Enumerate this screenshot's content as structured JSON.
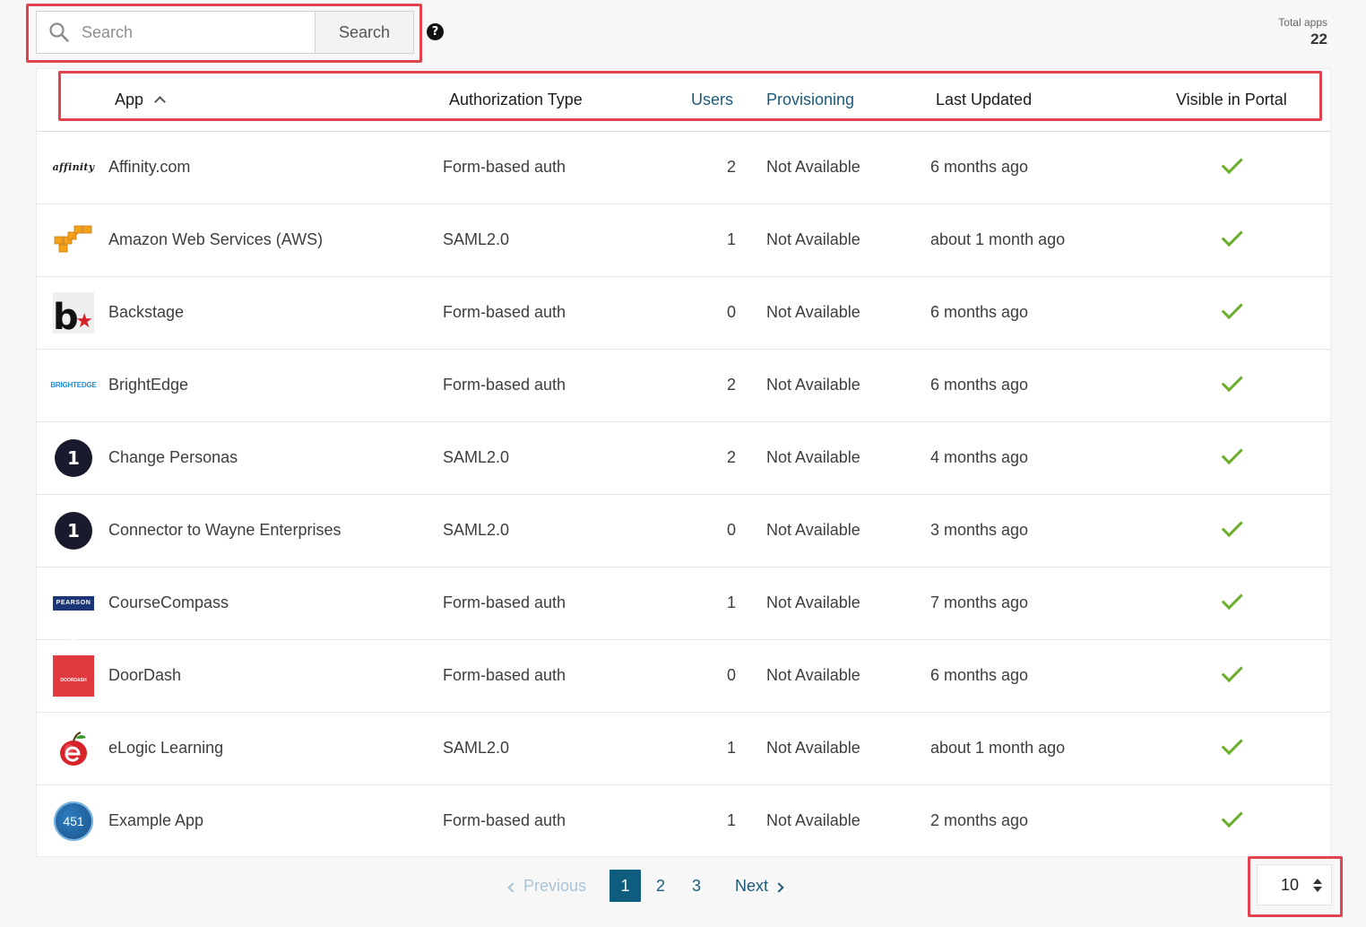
{
  "search": {
    "placeholder": "Search",
    "button_label": "Search",
    "help_glyph": "?"
  },
  "total_apps": {
    "label": "Total apps",
    "value": "22"
  },
  "table": {
    "columns": {
      "app": "App",
      "auth": "Authorization Type",
      "users": "Users",
      "provisioning": "Provisioning",
      "last_updated": "Last Updated",
      "visible": "Visible in Portal"
    },
    "rows": [
      {
        "name": "Affinity.com",
        "auth": "Form-based auth",
        "users": "2",
        "provisioning": "Not Available",
        "updated": "6 months ago",
        "logo_text": "affinity"
      },
      {
        "name": "Amazon Web Services (AWS)",
        "auth": "SAML2.0",
        "users": "1",
        "provisioning": "Not Available",
        "updated": "about 1 month ago"
      },
      {
        "name": "Backstage",
        "auth": "Form-based auth",
        "users": "0",
        "provisioning": "Not Available",
        "updated": "6 months ago",
        "logo_text": "b"
      },
      {
        "name": "BrightEdge",
        "auth": "Form-based auth",
        "users": "2",
        "provisioning": "Not Available",
        "updated": "6 months ago",
        "logo_text": "BRIGHTEDGE"
      },
      {
        "name": "Change Personas",
        "auth": "SAML2.0",
        "users": "2",
        "provisioning": "Not Available",
        "updated": "4 months ago",
        "logo_text": "1"
      },
      {
        "name": "Connector to Wayne Enterprises",
        "auth": "SAML2.0",
        "users": "0",
        "provisioning": "Not Available",
        "updated": "3 months ago",
        "logo_text": "1"
      },
      {
        "name": "CourseCompass",
        "auth": "Form-based auth",
        "users": "1",
        "provisioning": "Not Available",
        "updated": "7 months ago",
        "logo_text": "PEARSON"
      },
      {
        "name": "DoorDash",
        "auth": "Form-based auth",
        "users": "0",
        "provisioning": "Not Available",
        "updated": "6 months ago",
        "logo_text": "DOORDASH"
      },
      {
        "name": "eLogic Learning",
        "auth": "SAML2.0",
        "users": "1",
        "provisioning": "Not Available",
        "updated": "about 1 month ago"
      },
      {
        "name": "Example App",
        "auth": "Form-based auth",
        "users": "1",
        "provisioning": "Not Available",
        "updated": "2 months ago",
        "logo_text": "451"
      }
    ]
  },
  "pagination": {
    "previous": "Previous",
    "pages": [
      "1",
      "2",
      "3"
    ],
    "next": "Next",
    "per_page": "10"
  },
  "colors": {
    "accent": "#0f5d7e",
    "link": "#1c5a7a",
    "check": "#6aae2a",
    "annotation": "#e0444e"
  }
}
